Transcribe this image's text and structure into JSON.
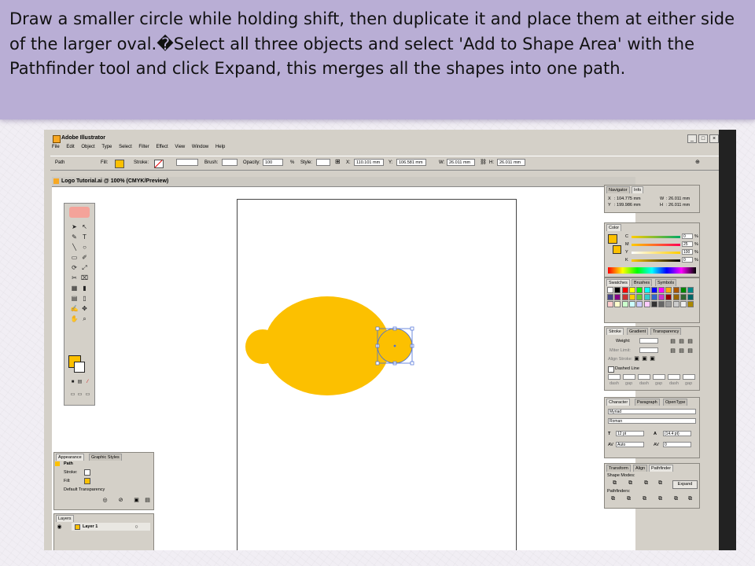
{
  "slide": {
    "text": "Draw a smaller circle while holding shift, then duplicate it and place them at either side of the larger oval.�Select all three objects and select 'Add to Shape Area' with the Pathfinder tool and click Expand, this merges all the shapes into one path."
  },
  "colors": {
    "banner": "#b9aed5",
    "shape_fill": "#fcc000",
    "selection": "#4a6fd8"
  },
  "app": {
    "title": "Adobe Illustrator",
    "menu": [
      "File",
      "Edit",
      "Object",
      "Type",
      "Select",
      "Filter",
      "Effect",
      "View",
      "Window",
      "Help"
    ],
    "window_buttons": [
      "_",
      "□",
      "×"
    ]
  },
  "control": {
    "object": "Path",
    "fill_label": "Fill:",
    "stroke_label": "Stroke:",
    "brush_label": "Brush:",
    "opacity_label": "Opacity:",
    "opacity_value": "100",
    "opacity_unit": "%",
    "style_label": "Style:",
    "x_label": "X:",
    "x_value": "110.101 mm",
    "y_label": "Y:",
    "y_value": "106.581 mm",
    "w_label": "W:",
    "w_value": "26.011 mm",
    "h_label": "H:",
    "h_value": "26.011 mm"
  },
  "document": {
    "title": "Logo Tutorial.ai @ 100% (CMYK/Preview)"
  },
  "toolbox": {
    "tools": [
      "➤",
      "↖",
      "✎",
      "T",
      "╲",
      "○",
      "▭",
      "✐",
      "⟳",
      "⤢",
      "✂",
      "⌧",
      "▦",
      "▮",
      "▤",
      "▯",
      "✍",
      "✥",
      "✋",
      "⌕"
    ]
  },
  "navigator": {
    "tabs": [
      "Navigator",
      "Info"
    ],
    "x_label": "X",
    "x_value": ": 104.775 mm",
    "y_label": "Y",
    "y_value": ": 199.986 mm",
    "w_label": "W",
    "w_value": ": 26.011 mm",
    "h_label": "H",
    "h_value": ": 26.011 mm"
  },
  "color_panel": {
    "tab": "Color",
    "channels": [
      {
        "label": "C",
        "value": "0",
        "unit": "%"
      },
      {
        "label": "M",
        "value": "25",
        "unit": "%"
      },
      {
        "label": "Y",
        "value": "100",
        "unit": "%"
      },
      {
        "label": "K",
        "value": "0",
        "unit": "%"
      }
    ]
  },
  "swatches": {
    "tabs": [
      "Swatches",
      "Brushes",
      "Symbols"
    ]
  },
  "stroke_panel": {
    "tabs": [
      "Stroke",
      "Gradient",
      "Transparency"
    ],
    "weight_label": "Weight:",
    "miter_label": "Miter Limit:",
    "align_label": "Align Stroke:",
    "dashed_label": "Dashed Line",
    "dash_labels": [
      "dash",
      "gap",
      "dash",
      "gap",
      "dash",
      "gap"
    ]
  },
  "character": {
    "tabs": [
      "Character",
      "Paragraph",
      "OpenType"
    ],
    "font": "Myriad",
    "style": "Roman",
    "size": "12 pt",
    "leading": "(14.4 pt)",
    "kerning": "Auto",
    "tracking": "0"
  },
  "pathfinder": {
    "tabs": [
      "Transform",
      "Align",
      "Pathfinder"
    ],
    "shape_modes_label": "Shape Modes:",
    "expand_label": "Expand",
    "pathfinders_label": "Pathfinders:"
  },
  "appearance": {
    "tabs": [
      "Appearance",
      "Graphic Styles"
    ],
    "items": [
      "Path",
      "Stroke:",
      "Fill:",
      "Default Transparency"
    ]
  },
  "layers": {
    "tab": "Layers",
    "layer": "Layer 1"
  }
}
